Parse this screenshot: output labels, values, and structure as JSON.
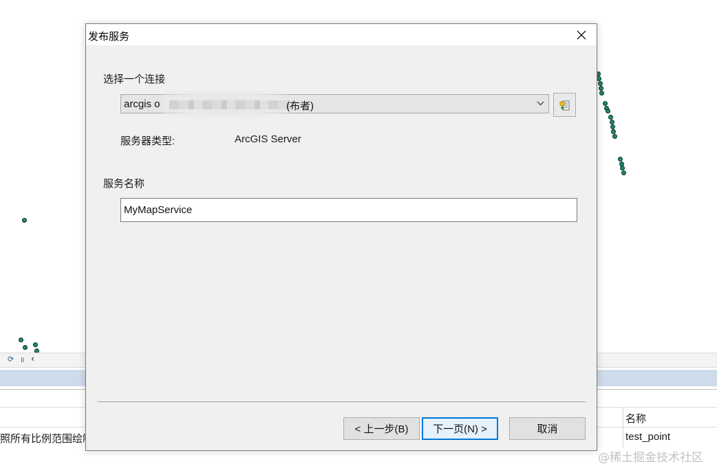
{
  "dialog": {
    "title": "发布服务",
    "select_connection_label": "选择一个连接",
    "connection": {
      "value_prefix": "arcgis o",
      "value_suffix": "(布者)"
    },
    "server_type_label": "服务器类型:",
    "server_type_value": "ArcGIS Server",
    "service_name_label": "服务名称",
    "service_name_value": "MyMapService",
    "buttons": {
      "back": "< 上一步(B)",
      "next": "下一页(N) >",
      "cancel": "取消"
    }
  },
  "background": {
    "table_header_name": "名称",
    "row_left_text": "照所有比例范围绘制",
    "row_name_value": "test_point",
    "watermark": "@稀土掘金技术社区"
  },
  "colors": {
    "accent": "#0078d7",
    "map_point": "#1f8a73",
    "attribute_bar": "#cddbea"
  }
}
